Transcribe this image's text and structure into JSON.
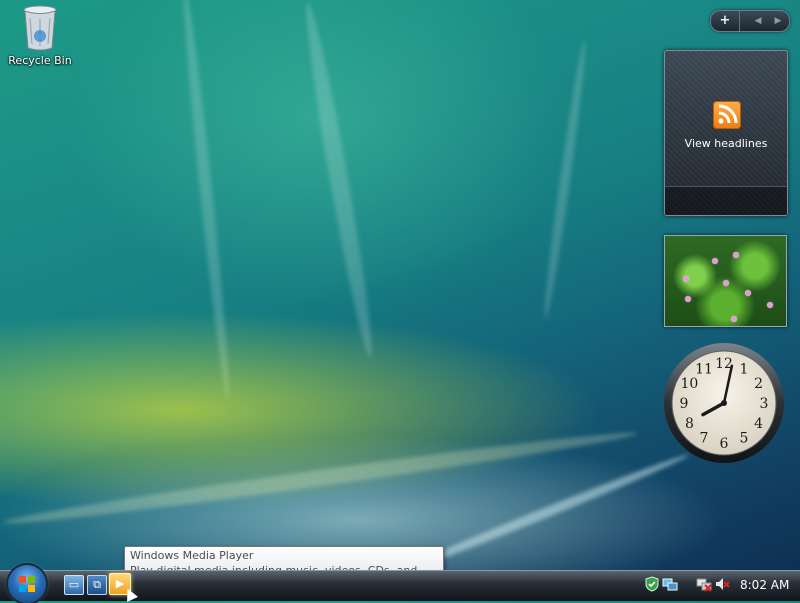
{
  "desktop": {
    "icons": [
      {
        "label": "Recycle Bin",
        "icon": "recycle-bin-icon"
      }
    ]
  },
  "sidebar": {
    "controls": {
      "add_label": "+",
      "prev_label": "◀",
      "next_label": "▶"
    },
    "feed_gadget": {
      "label": "View headlines",
      "icon": "rss-icon"
    },
    "slideshow_gadget": {
      "icon": "flower-photo-icon"
    },
    "clock_gadget": {
      "numbers": [
        "12",
        "1",
        "2",
        "3",
        "4",
        "5",
        "6",
        "7",
        "8",
        "9",
        "10",
        "11"
      ],
      "hour": 8,
      "minute": 2
    }
  },
  "taskbar": {
    "quick_launch": [
      {
        "icon": "show-desktop-icon"
      },
      {
        "icon": "switch-windows-icon"
      },
      {
        "icon": "windows-media-player-icon"
      }
    ],
    "tray": {
      "time": "8:02 AM",
      "icons": [
        "shield-icon",
        "network-icon",
        "volume-muted-icon"
      ]
    }
  },
  "tooltip": {
    "title": "Windows Media Player",
    "description": "Play digital media including music, videos, CDs, and DVDs."
  },
  "colors": {
    "accent": "#f07a10",
    "taskbar": "#10151a",
    "wallpaper_top": "#1c9a86",
    "wallpaper_bottom": "#0d2c4d"
  }
}
